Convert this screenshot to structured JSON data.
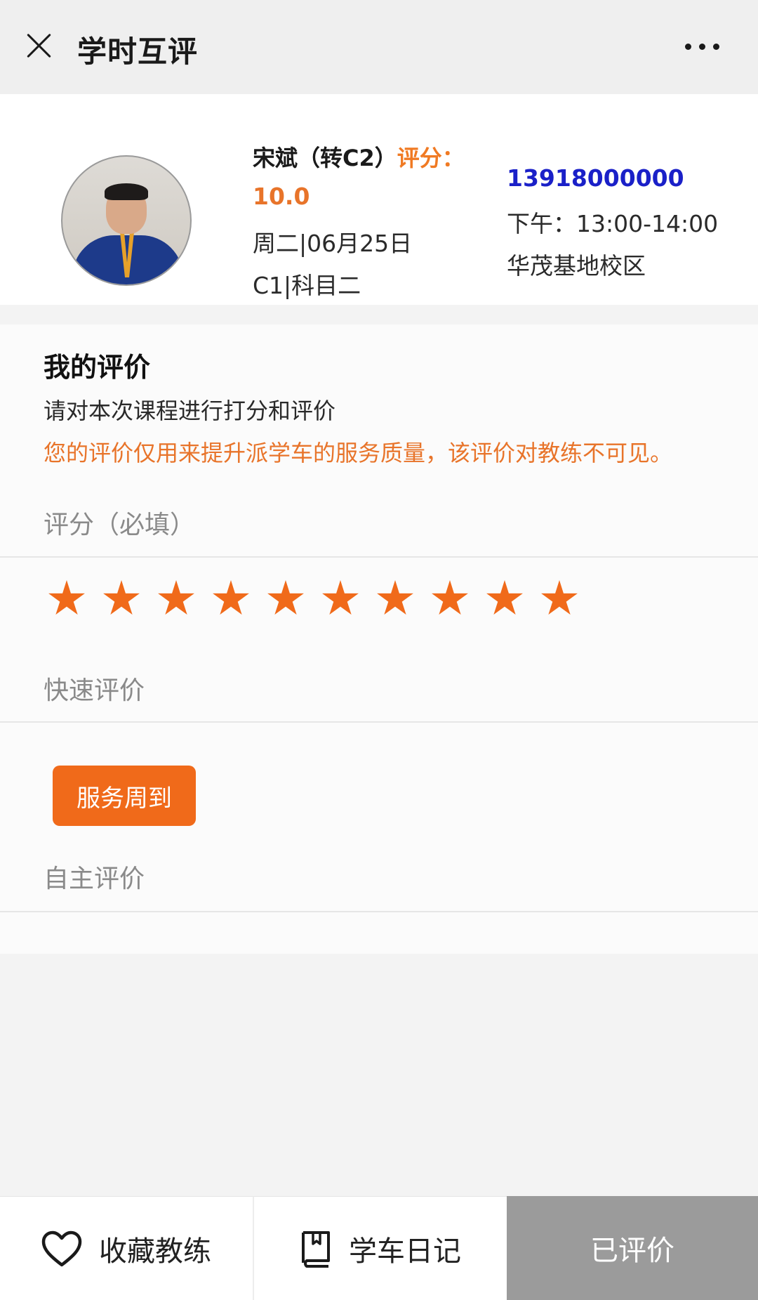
{
  "header": {
    "title": "学时互评",
    "close_icon": "close-icon",
    "more_icon": "more-dots-icon"
  },
  "coach": {
    "name": "宋斌（转C2）",
    "score_label": "评分：",
    "score_value": "10.0",
    "date": "周二|06月25日",
    "subject": "C1|科目二",
    "phone": "13918000000",
    "time_slot": "下午：13:00-14:00",
    "campus": "华茂基地校区"
  },
  "evaluation": {
    "title": "我的评价",
    "instruction": "请对本次课程进行打分和评价",
    "note": "您的评价仅用来提升派学车的服务质量，该评价对教练不可见。",
    "rating_label": "评分（必填）",
    "rating_value": 10,
    "rating_max": 10,
    "quick_label": "快速评价",
    "quick_tags": [
      "服务周到"
    ],
    "free_label": "自主评价"
  },
  "bottom_bar": {
    "favorite_label": "收藏教练",
    "diary_label": "学车日记",
    "rated_label": "已评价"
  },
  "colors": {
    "accent_orange": "#f06a1a",
    "phone_blue": "#1a20c8",
    "disabled_gray": "#9b9b9b"
  }
}
